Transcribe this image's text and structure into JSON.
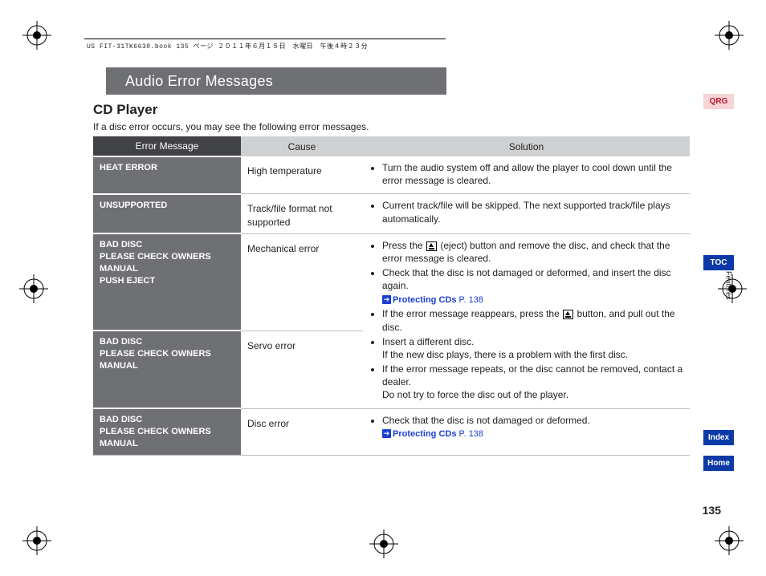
{
  "meta": {
    "book_header": "US FIT-31TK6630.book  135 ページ  ２０１１年６月１５日　水曜日　午後４時２３分"
  },
  "title": "Audio Error Messages",
  "section": "CD Player",
  "intro": "If a disc error occurs, you may see the following error messages.",
  "table": {
    "headers": {
      "error": "Error Message",
      "cause": "Cause",
      "solution": "Solution"
    },
    "rows": [
      {
        "error": "HEAT ERROR",
        "cause": "High temperature",
        "solution_items": [
          "Turn the audio system off and allow the player to cool down until the error message is cleared."
        ]
      },
      {
        "error": "UNSUPPORTED",
        "cause": "Track/file format not supported",
        "solution_items": [
          "Current track/file will be skipped. The next supported track/file plays automatically."
        ]
      },
      {
        "error": "BAD DISC\nPLEASE CHECK OWNERS MANUAL\nPUSH EJECT",
        "cause": "Mechanical error"
      },
      {
        "error": "BAD DISC\nPLEASE CHECK OWNERS MANUAL",
        "cause": "Servo error"
      },
      {
        "error": "BAD DISC\nPLEASE CHECK OWNERS MANUAL",
        "cause": "Disc error",
        "solution_items": [
          "Check that the disc is not damaged or deformed."
        ],
        "solution_xref": {
          "label": "Protecting CDs",
          "page": "P. 138"
        }
      }
    ],
    "merged_solution": {
      "s1a": "Press the ",
      "s1b": " (eject) button and remove the disc, and check that the error message is cleared.",
      "s2": "Check that the disc is not damaged or deformed, and insert the disc again.",
      "xref": {
        "label": "Protecting CDs",
        "page": "P. 138"
      },
      "s3a": "If the error message reappears, press the ",
      "s3b": " button, and pull out the disc.",
      "s4": "Insert a different disc.",
      "s4sub": "If the new disc plays, there is a problem with the first disc.",
      "s5": "If the error message repeats, or the disc cannot be removed, contact a dealer.",
      "s5sub": "Do not try to force the disc out of the player."
    }
  },
  "tabs": {
    "qrg": "QRG",
    "toc": "TOC",
    "features": "Features",
    "index": "Index",
    "home": "Home"
  },
  "page_number": "135"
}
